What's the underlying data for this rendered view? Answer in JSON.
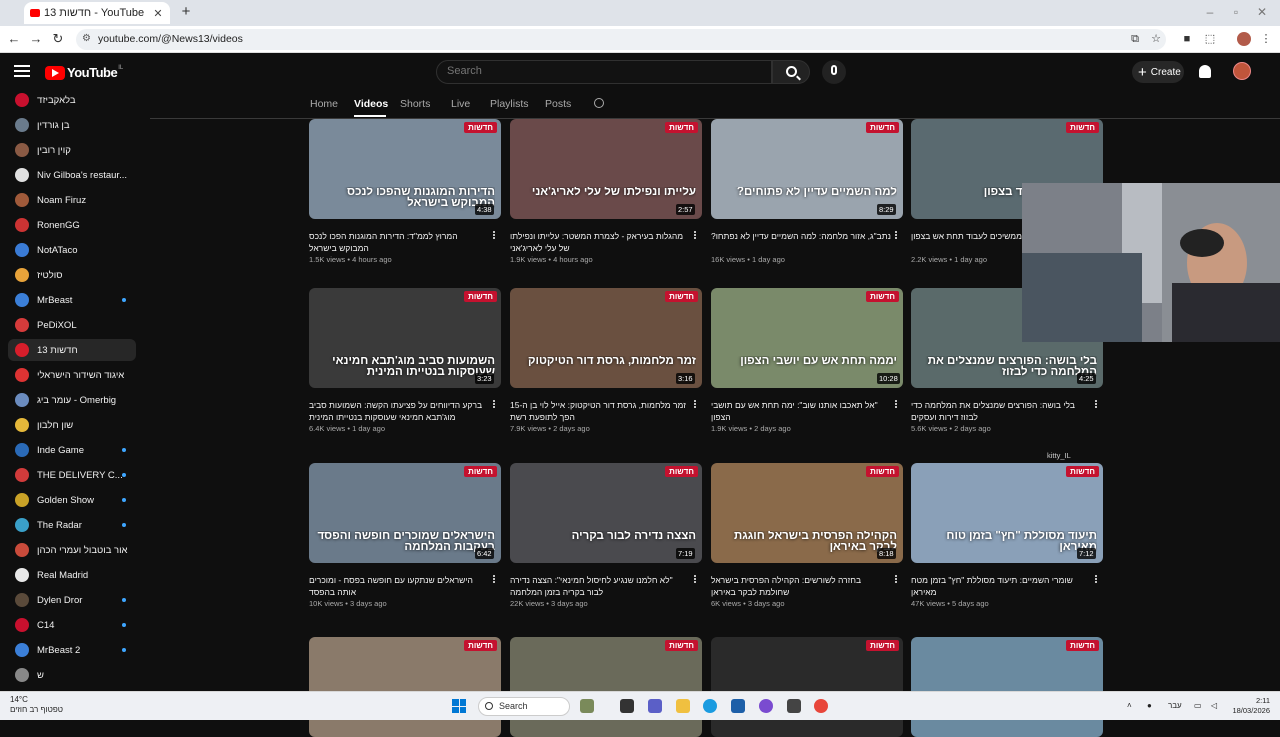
{
  "browser": {
    "tab_title": "חדשות 13 - YouTube",
    "tab_close": "✕",
    "new_tab": "+",
    "url": "youtube.com/@News13/videos"
  },
  "header": {
    "logo_text": "YouTube",
    "logo_region": "IL",
    "search_placeholder": "Search",
    "create_label": "Create"
  },
  "sidebar": {
    "items": [
      {
        "name": "בלאקביזד",
        "color": "#c8102e",
        "dot": false
      },
      {
        "name": "בן גורדין",
        "color": "#6a7b8c",
        "dot": false
      },
      {
        "name": "קוין רובין",
        "color": "#8a5a44",
        "dot": false
      },
      {
        "name": "Niv Gilboa's restaur...",
        "color": "#e0e0e0",
        "dot": false
      },
      {
        "name": "Noam Firuz",
        "color": "#a05a3a",
        "dot": false
      },
      {
        "name": "RonenGG",
        "color": "#cc3333",
        "dot": false
      },
      {
        "name": "NotATaco",
        "color": "#3a7bd5",
        "dot": false
      },
      {
        "name": "סולטיז",
        "color": "#e8a33a",
        "dot": false
      },
      {
        "name": "MrBeast",
        "color": "#3b7fd8",
        "dot": true
      },
      {
        "name": "PeDiXOL",
        "color": "#d63b3b",
        "dot": false
      },
      {
        "name": "חדשות 13",
        "color": "#d71e2b",
        "dot": false
      },
      {
        "name": "איגוד השידור הישראלי",
        "color": "#d33",
        "dot": false
      },
      {
        "name": "עומר ביג - Omerbig",
        "color": "#6b8cbf",
        "dot": false
      },
      {
        "name": "שון חלבון",
        "color": "#e5b83a",
        "dot": false
      },
      {
        "name": "Inde Game",
        "color": "#2a6ab7",
        "dot": true
      },
      {
        "name": "THE DELIVERY C...",
        "color": "#d13b3b",
        "dot": true
      },
      {
        "name": "Golden Show",
        "color": "#c9a227",
        "dot": true
      },
      {
        "name": "The Radar",
        "color": "#3aa0c9",
        "dot": true
      },
      {
        "name": "אור בוטבול ועמרי הכהן",
        "color": "#c94b3b",
        "dot": false
      },
      {
        "name": "Real Madrid",
        "color": "#e8e8e8",
        "dot": false
      },
      {
        "name": "Dylen Dror",
        "color": "#5a4a3a",
        "dot": true
      },
      {
        "name": "C14",
        "color": "#c8102e",
        "dot": true
      },
      {
        "name": "MrBeast 2",
        "color": "#3b7fd8",
        "dot": true
      },
      {
        "name": "ש",
        "color": "#888",
        "dot": false
      }
    ]
  },
  "channel_tabs": [
    "Home",
    "Videos",
    "Shorts",
    "Live",
    "Playlists",
    "Posts"
  ],
  "badge_text": "חדשות",
  "videos": [
    {
      "overlay": "הדירות המוגנות שהפכו לנכס המבוקש בישראל",
      "duration": "4:38",
      "title": "המרוץ לממ\"ד: הדירות המוגנות הפכו לנכס המבוקש בישראל",
      "views": "1.5K views",
      "age": "4 hours ago",
      "bg": "#7a8a9a"
    },
    {
      "overlay": "עלייתו ונפילתו של עלי לאריג'אני",
      "duration": "2:57",
      "title": "מהגלות בעיראק - לצמרת המשטר: עלייתו ונפילתו של עלי לאריג'אני",
      "views": "1.9K views",
      "age": "4 hours ago",
      "bg": "#6a4a4a"
    },
    {
      "overlay": "למה השמיים עדיין לא פתוחים?",
      "duration": "8:29",
      "title": "נתב\"ג, אזור מלחמה: למה השמיים עדיין לא נפתחו?",
      "views": "16K views",
      "age": "1 day ago",
      "bg": "#9aa4ae"
    },
    {
      "overlay": "ממשיכים לעבוד בצפון",
      "duration": "",
      "title": "העובדים שממשיכים לעבוד תחת אש בצפון",
      "views": "2.2K views",
      "age": "1 day ago",
      "bg": "#5a6a70"
    },
    {
      "overlay": "השמועות סביב מוג'תבא חמינאי שעוסקות בנטייתו המינית",
      "duration": "3:23",
      "title": "ברקע הדיווחים על פציעתו הקשה: השמועות סביב מוג'תבא חמינאי שעוסקות בנטייתו המינית",
      "views": "6.4K views",
      "age": "1 day ago",
      "bg": "#3a3a3a"
    },
    {
      "overlay": "זמר מלחמות, גרסת דור הטיקטוק",
      "duration": "3:16",
      "title": "זמר מלחמות, גרסת דור הטיקטוק: אייל לוי בן ה-15 הפך לתופעת רשת",
      "views": "7.9K views",
      "age": "2 days ago",
      "bg": "#6a5040"
    },
    {
      "overlay": "יממה תחת אש עם יושבי הצפון",
      "duration": "10:28",
      "title": "\"אל תאכבו אותנו שוב\": ימה תחת אש עם תושבי הצפון",
      "views": "1.9K views",
      "age": "2 days ago",
      "bg": "#7a8a6a"
    },
    {
      "overlay": "בלי בושה: הפורצים שמנצלים את המלחמה כדי לבזוז",
      "duration": "4:25",
      "title": "בלי בושה: הפורצים שמנצלים את המלחמה כדי לבזוז דירות ועסקים",
      "views": "5.6K views",
      "age": "2 days ago",
      "bg": "#5a6a6a"
    },
    {
      "overlay": "הישראלים שמוכרים חופשה והפסד בעקבות המלחמה",
      "duration": "6:42",
      "title": "הישראלים שנתקעו עם חופשה בפסח - ומוכרים אותה בהפסד",
      "views": "10K views",
      "age": "3 days ago",
      "bg": "#6a7a8a"
    },
    {
      "overlay": "הצצה נדירה לבור בקריה",
      "duration": "7:19",
      "title": "\"לא חלמנו שנגיע לחיסול חמינאי\": הצצה נדירה לבור בקריה בזמן המלחמה",
      "views": "22K views",
      "age": "3 days ago",
      "bg": "#4a4a4e"
    },
    {
      "overlay": "הקהילה הפרסית בישראל חוגגת לבקר באיראן",
      "duration": "8:18",
      "title": "בחזרה לשורשים: הקהילה הפרסית בישראל שחולמת לבקר באיראן",
      "views": "6K views",
      "age": "3 days ago",
      "bg": "#8a6a4a"
    },
    {
      "overlay": "תיעוד מסוללת \"חץ\" בזמן טוח מאיראן",
      "duration": "7:12",
      "title": "שומרי השמיים: תיעוד מסוללת \"חץ\" בזמן מטח מאיראן",
      "views": "47K views",
      "age": "5 days ago",
      "bg": "#8aa0b8"
    },
    {
      "overlay": "",
      "duration": "",
      "title": "",
      "views": "",
      "age": "",
      "bg": "#8a7a6a"
    },
    {
      "overlay": "",
      "duration": "",
      "title": "",
      "views": "",
      "age": "",
      "bg": "#6a6a5a"
    },
    {
      "overlay": "",
      "duration": "",
      "title": "",
      "views": "",
      "age": "",
      "bg": "#2a2a2a"
    },
    {
      "overlay": "",
      "duration": "",
      "title": "",
      "views": "",
      "age": "",
      "bg": "#6a8aa0"
    }
  ],
  "webcam_user": "kitty_IL",
  "taskbar": {
    "temp": "14°C",
    "weather": "טפטוף רב חוזים",
    "search": "Search",
    "lang": "עבר",
    "time": "2:11",
    "date": "18/03/2026"
  }
}
